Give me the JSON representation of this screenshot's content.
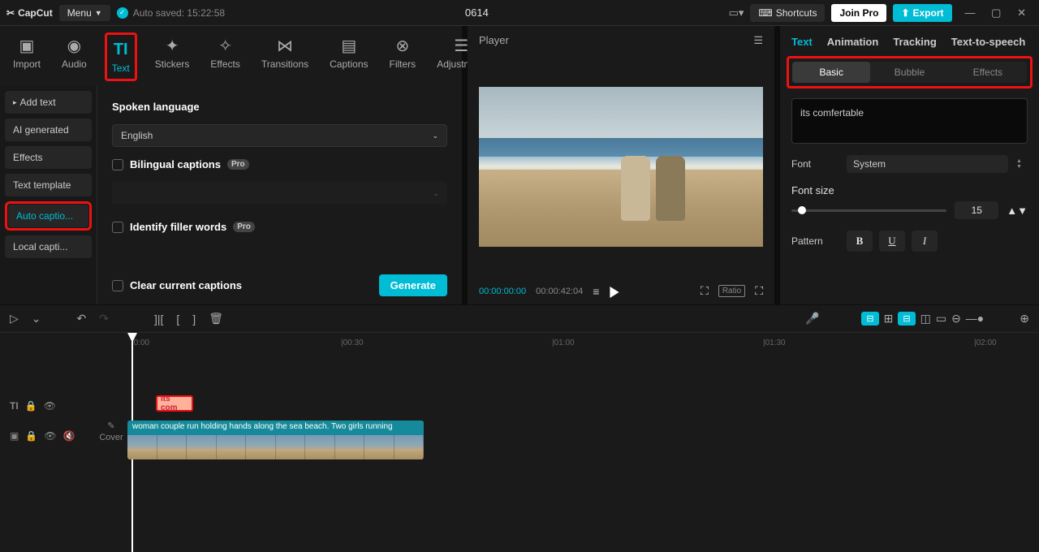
{
  "titlebar": {
    "app_name": "CapCut",
    "menu_label": "Menu",
    "autosave": "Auto saved: 15:22:58",
    "project_title": "0614",
    "shortcuts": "Shortcuts",
    "join_pro": "Join Pro",
    "export": "Export"
  },
  "top_tabs": {
    "import": "Import",
    "audio": "Audio",
    "text": "Text",
    "stickers": "Stickers",
    "effects": "Effects",
    "transitions": "Transitions",
    "captions": "Captions",
    "filters": "Filters",
    "adjustment": "Adjustment"
  },
  "left_list": {
    "add_text": "Add text",
    "ai_generated": "AI generated",
    "effects": "Effects",
    "text_template": "Text template",
    "auto_captions": "Auto captio...",
    "local_captions": "Local capti..."
  },
  "form": {
    "spoken_language_label": "Spoken language",
    "language_value": "English",
    "bilingual_label": "Bilingual captions",
    "pro_badge": "Pro",
    "filler_label": "Identify filler words",
    "clear_label": "Clear current captions",
    "generate": "Generate"
  },
  "player": {
    "title": "Player",
    "time_current": "00:00:00:00",
    "time_total": "00:00:42:04",
    "ratio_label": "Ratio"
  },
  "inspector": {
    "tabs": {
      "text": "Text",
      "animation": "Animation",
      "tracking": "Tracking",
      "tts": "Text-to-speech"
    },
    "sub": {
      "basic": "Basic",
      "bubble": "Bubble",
      "effects": "Effects"
    },
    "text_value": "its comfertable",
    "font_label": "Font",
    "font_value": "System",
    "fontsize_label": "Font size",
    "fontsize_value": "15",
    "pattern_label": "Pattern",
    "bold": "B",
    "underline": "U",
    "italic": "I"
  },
  "timeline": {
    "marks": {
      "m0": "|0:00",
      "m1": "|00:30",
      "m2": "|01:00",
      "m3": "|01:30",
      "m4": "|02:00"
    },
    "cover": "Cover",
    "caption_clip": "its com",
    "video_label": "woman couple run holding hands along the sea beach. Two girls running"
  }
}
